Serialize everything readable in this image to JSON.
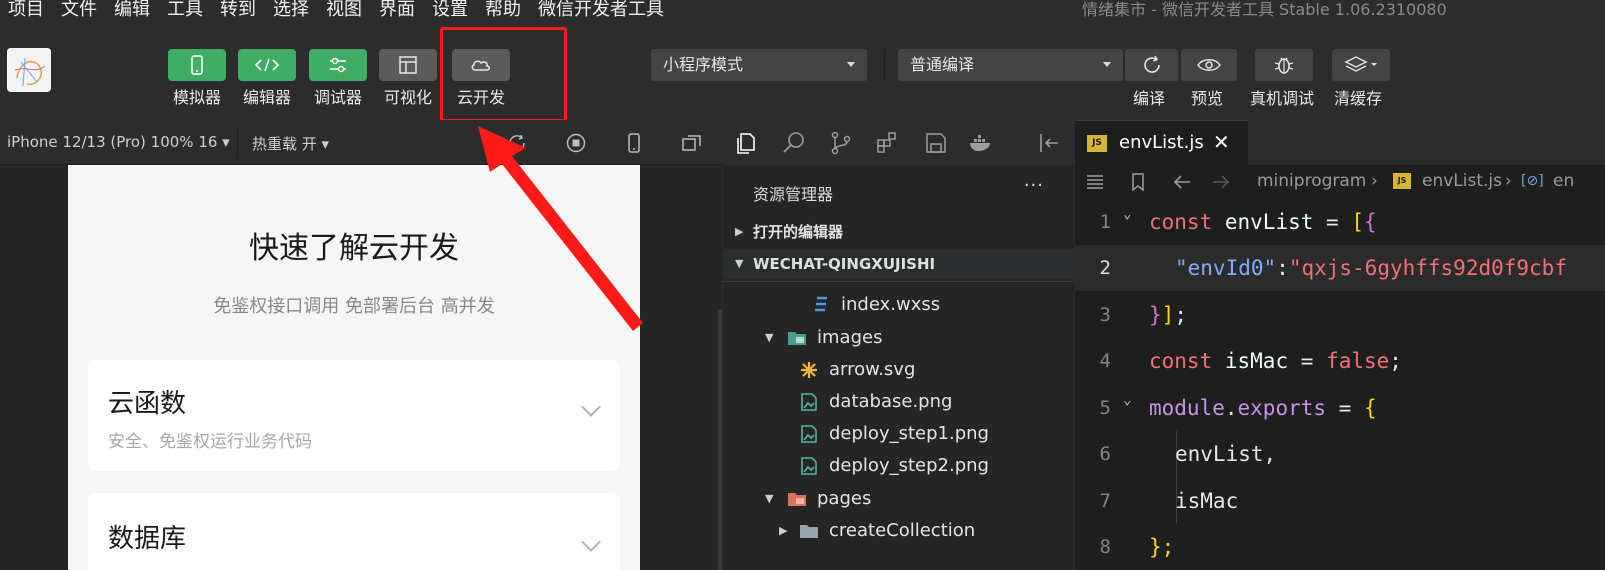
{
  "menu": {
    "items": [
      "项目",
      "文件",
      "编辑",
      "工具",
      "转到",
      "选择",
      "视图",
      "界面",
      "设置",
      "帮助",
      "微信开发者工具"
    ],
    "app_title": "情绪集市 - 微信开发者工具 Stable 1.06.2310080"
  },
  "toolbar": {
    "tools": [
      {
        "label": "模拟器",
        "icon": "phone-icon",
        "style": "green"
      },
      {
        "label": "编辑器",
        "icon": "code-icon",
        "style": "green"
      },
      {
        "label": "调试器",
        "icon": "debug-sliders-icon",
        "style": "green"
      },
      {
        "label": "可视化",
        "icon": "layout-icon",
        "style": "gray"
      },
      {
        "label": "云开发",
        "icon": "cloud-icon",
        "style": "gray"
      }
    ],
    "mode_select": "小程序模式",
    "compile_select": "普通编译",
    "compile_label": "编译",
    "preview_label": "预览",
    "remote_debug_label": "真机调试",
    "clear_cache_label": "清缓存"
  },
  "simulator": {
    "device": "iPhone 12/13 (Pro) 100% 16 ▾",
    "hot_reload": "热重载 开 ▾",
    "page": {
      "title": "快速了解云开发",
      "subtitle": "免鉴权接口调用 免部署后台 高并发",
      "cards": [
        {
          "title": "云函数",
          "desc": "安全、免鉴权运行业务代码"
        },
        {
          "title": "数据库",
          "desc": ""
        }
      ]
    }
  },
  "explorer": {
    "title": "资源管理器",
    "more": "···",
    "open_editors": "打开的编辑器",
    "project": "WECHAT-QINGXUJISHI",
    "tree": [
      {
        "name": "index.wxss",
        "type": "css"
      },
      {
        "name": "images",
        "type": "folder-open"
      },
      {
        "name": "arrow.svg",
        "type": "svg"
      },
      {
        "name": "database.png",
        "type": "image"
      },
      {
        "name": "deploy_step1.png",
        "type": "image"
      },
      {
        "name": "deploy_step2.png",
        "type": "image"
      },
      {
        "name": "pages",
        "type": "folder-open"
      },
      {
        "name": "createCollection",
        "type": "folder"
      }
    ]
  },
  "editor": {
    "tab": {
      "name": "envList.js",
      "close": "✕",
      "badge": "JS"
    },
    "breadcrumb": {
      "folder": "miniprogram",
      "file": "envList.js",
      "symbol": "en"
    },
    "lines": [
      {
        "n": "1"
      },
      {
        "n": "2"
      },
      {
        "n": "3"
      },
      {
        "n": "4"
      },
      {
        "n": "5"
      },
      {
        "n": "6"
      },
      {
        "n": "7"
      },
      {
        "n": "8"
      }
    ],
    "code": {
      "l1_kw": "const",
      "l1_var": "envList",
      "l1_op": "=",
      "l2_key": "\"envId0\"",
      "l2_val": "\"qxjs-6gyhffs92d0f9cbf",
      "l4_kw": "const",
      "l4_var": "isMac",
      "l4_val": "false",
      "l5_mod": "module",
      "l5_prop": "exports",
      "l6": "envList,",
      "l7": "isMac",
      "l8": "};"
    }
  },
  "colors": {
    "green": "#3fae64",
    "highlight": "#ff1a1a",
    "editor_bg": "#1e1e1e"
  }
}
